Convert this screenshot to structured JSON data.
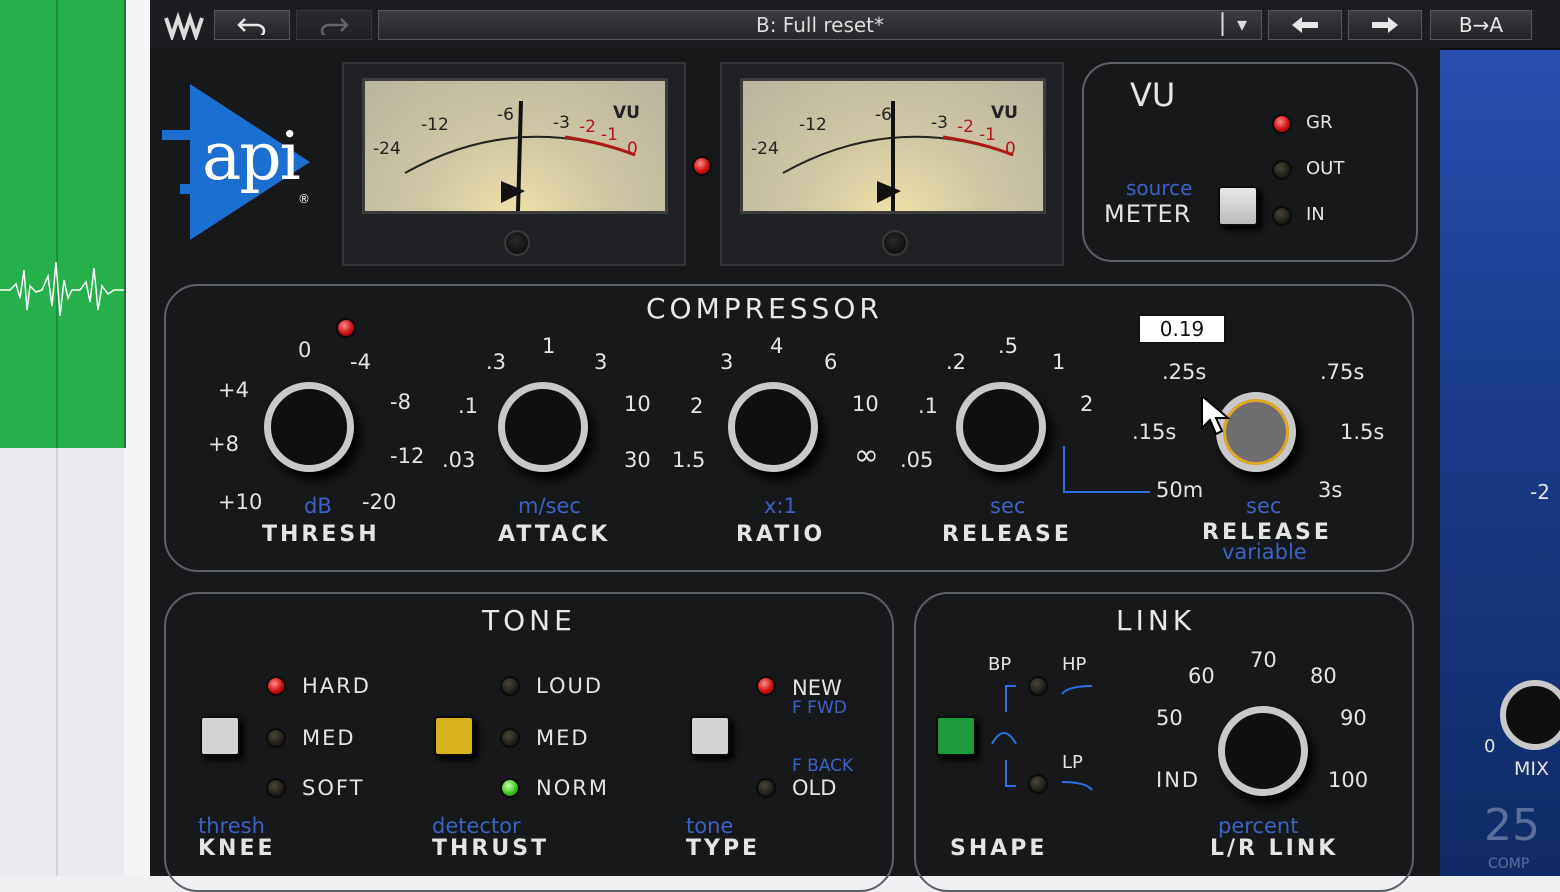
{
  "toolbar": {
    "preset_name": "B: Full reset*",
    "ab_label": "B→A",
    "dropdown_glyph": "▏▾",
    "undo_icon": "undo-icon",
    "redo_icon": "redo-icon",
    "prev_icon": "arrow-left-icon",
    "next_icon": "arrow-right-icon"
  },
  "logo": {
    "text": "api",
    "reg": "®"
  },
  "meters": {
    "scale_black": [
      "-24",
      "-12",
      "-6",
      "-3"
    ],
    "scale_red": [
      "-2",
      "-1",
      "0"
    ],
    "unit": "VU"
  },
  "vu_panel": {
    "title": "VU",
    "leds": [
      {
        "label": "GR",
        "state": "on"
      },
      {
        "label": "OUT",
        "state": "off"
      },
      {
        "label": "IN",
        "state": "off"
      }
    ],
    "source_label": "source",
    "meter_label": "METER"
  },
  "compressor": {
    "title": "COMPRESSOR",
    "value_readout": "0.19",
    "thresh": {
      "scale": [
        "0",
        "-4",
        "-8",
        "-12",
        "-20",
        "+10",
        "+8",
        "+4"
      ],
      "unit": "dB",
      "label": "THRESH"
    },
    "attack": {
      "scale": [
        ".3",
        "1",
        "3",
        "10",
        "30",
        ".03",
        ".1"
      ],
      "unit": "m/sec",
      "label": "ATTACK"
    },
    "ratio": {
      "scale": [
        "3",
        "4",
        "6",
        "10",
        "∞",
        "1.5",
        "2"
      ],
      "unit": "x:1",
      "label": "RATIO"
    },
    "release": {
      "scale": [
        ".2",
        ".5",
        "1",
        "2",
        ".05",
        ".1"
      ],
      "unit": "sec",
      "label": "RELEASE"
    },
    "release_var": {
      "scale": [
        ".25s",
        ".75s",
        "1.5s",
        "3s",
        "50m",
        ".15s"
      ],
      "unit": "sec",
      "label": "RELEASE",
      "sublabel": "variable"
    }
  },
  "tone": {
    "title": "TONE",
    "knee": {
      "options": [
        "HARD",
        "MED",
        "SOFT"
      ],
      "active": "HARD",
      "sub": "thresh",
      "label": "KNEE"
    },
    "thrust": {
      "options": [
        "LOUD",
        "MED",
        "NORM"
      ],
      "active": "NORM",
      "sub": "detector",
      "label": "THRUST"
    },
    "type": {
      "new": "NEW",
      "new_sub": "F FWD",
      "old_sub": "F BACK",
      "old": "OLD",
      "sub": "tone",
      "label": "TYPE"
    },
    "colors": {
      "knee_btn": "#d4d4d4",
      "thrust_btn": "#d6b21e",
      "type_btn": "#d4d4d4"
    }
  },
  "link": {
    "title": "LINK",
    "shape_labels": [
      "BP",
      "HP",
      "LP"
    ],
    "shape_label": "SHAPE",
    "shape_btn_color": "#1f9a3a",
    "scale": [
      "60",
      "70",
      "80",
      "50",
      "90",
      "IND",
      "100"
    ],
    "sub": "percent",
    "label": "L/R LINK"
  },
  "mix": {
    "zero": "0",
    "label": "MIX",
    "side": "-2",
    "big": "25",
    "small": "COMP"
  }
}
